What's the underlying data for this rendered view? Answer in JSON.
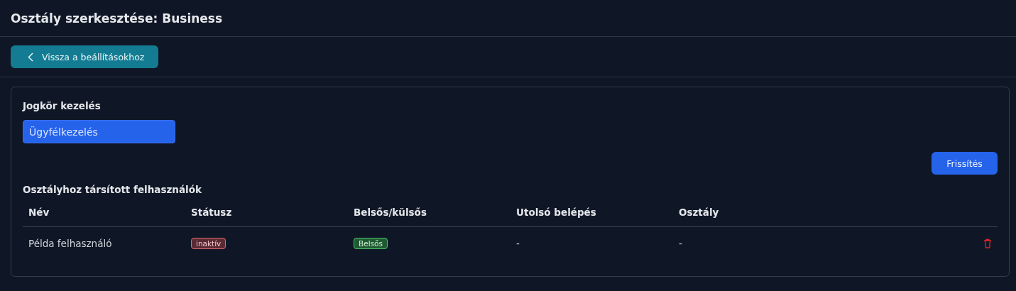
{
  "header": {
    "title": "Osztály szerkesztése: Business"
  },
  "back_button": {
    "label": "Vissza a beállításokhoz"
  },
  "role_section": {
    "title": "Jogkör kezelés",
    "select": {
      "value": "Ügyfélkezelés"
    },
    "refresh_button": {
      "label": "Frissítés"
    }
  },
  "users_section": {
    "title": "Osztályhoz társított felhasználók",
    "table": {
      "columns": [
        "Név",
        "Státusz",
        "Belsős/külsős",
        "Utolsó belépés",
        "Osztály"
      ],
      "rows": [
        {
          "name": "Példa felhasználó",
          "status": {
            "label": "inaktív",
            "kind": "danger"
          },
          "type": {
            "label": "Belsős",
            "kind": "success"
          },
          "last_login": "-",
          "department": "-"
        }
      ]
    }
  }
}
